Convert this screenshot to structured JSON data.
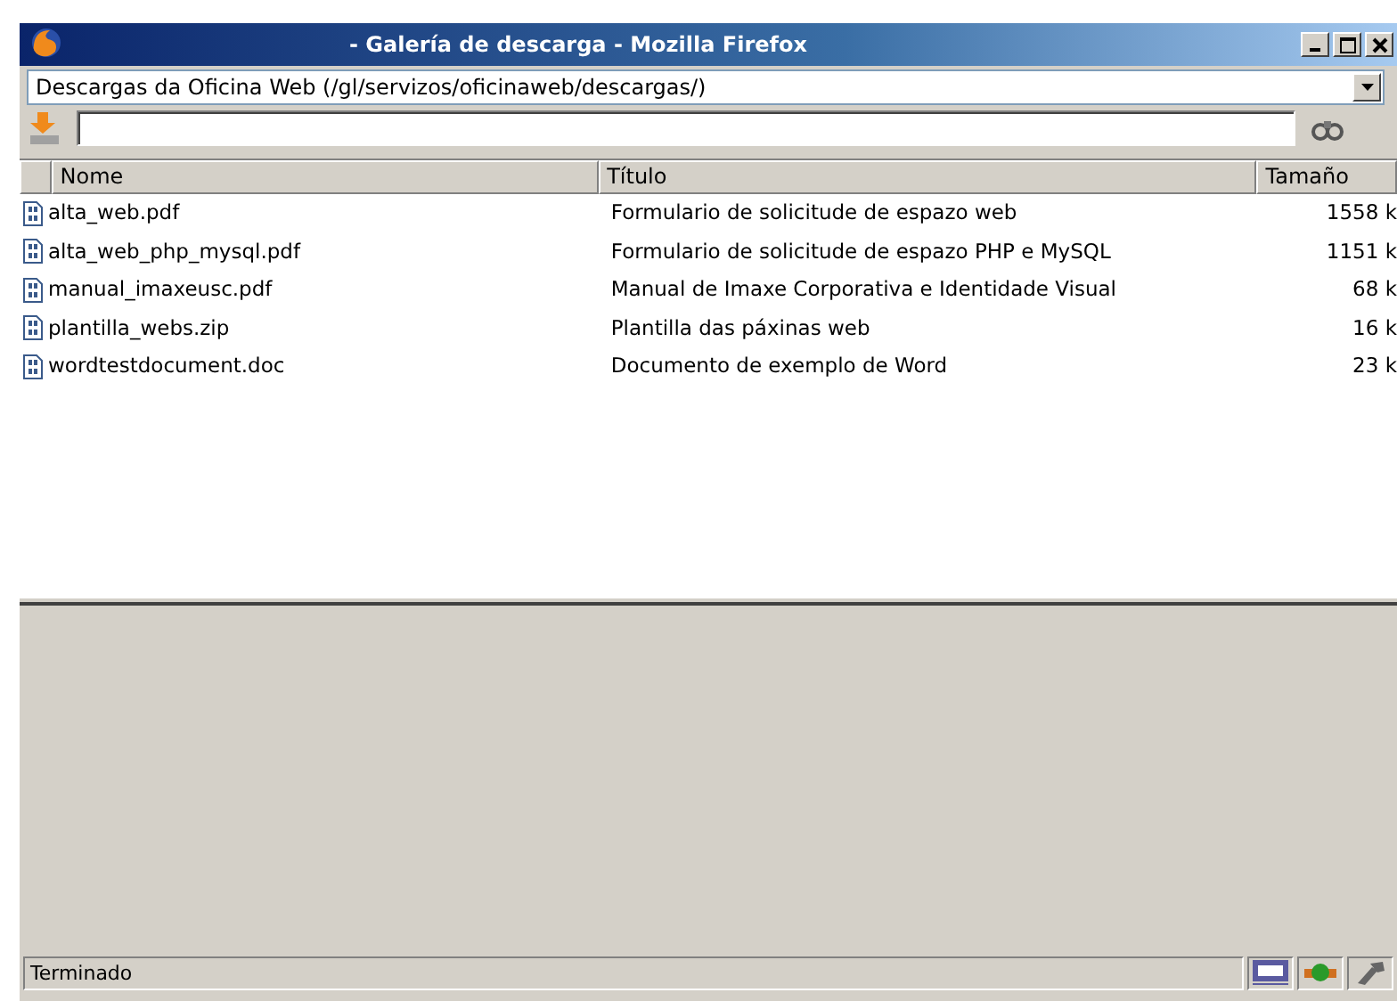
{
  "window": {
    "title": "- Galería de descarga - Mozilla Firefox"
  },
  "location": {
    "value": "Descargas da Oficina Web (/gl/servizos/oficinaweb/descargas/)"
  },
  "table": {
    "columns": [
      "Nome",
      "Título",
      "Tamaño"
    ],
    "rows": [
      {
        "name": "alta_web.pdf",
        "title": "Formulario de solicitude de espazo web",
        "size": "1558 k"
      },
      {
        "name": "alta_web_php_mysql.pdf",
        "title": "Formulario de solicitude de espazo PHP e MySQL",
        "size": "1151 k"
      },
      {
        "name": "manual_imaxeusc.pdf",
        "title": "Manual de Imaxe Corporativa e Identidade Visual",
        "size": "68 k"
      },
      {
        "name": "plantilla_webs.zip",
        "title": "Plantilla das páxinas web",
        "size": "16 k"
      },
      {
        "name": "wordtestdocument.doc",
        "title": "Documento de exemplo de Word",
        "size": "23 k"
      }
    ]
  },
  "status_bar": {
    "text": "Terminado"
  }
}
